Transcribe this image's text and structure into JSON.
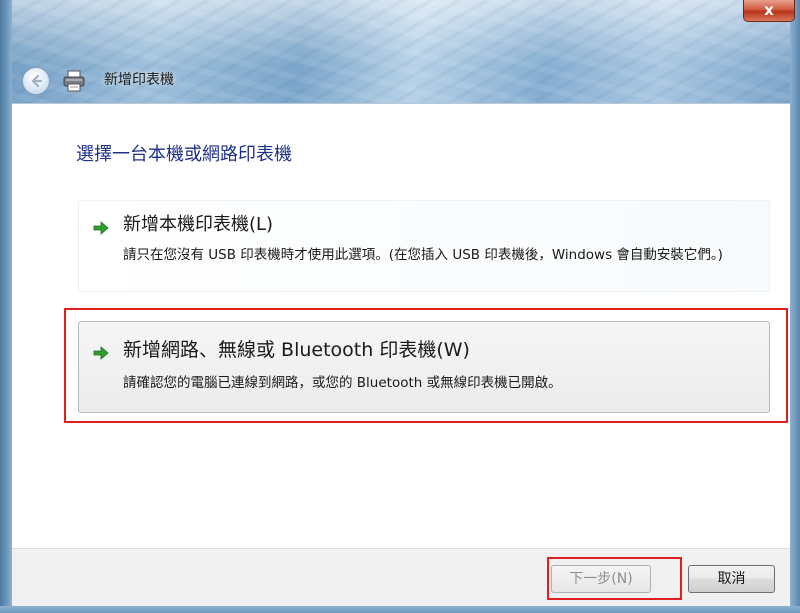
{
  "window": {
    "close_label": "x"
  },
  "nav": {
    "title": "新增印表機",
    "back_icon": "back-arrow-icon",
    "printer_icon": "printer-icon"
  },
  "main": {
    "heading": "選擇一台本機或網路印表機",
    "options": [
      {
        "title": "新增本機印表機(L)",
        "description": "請只在您沒有 USB 印表機時才使用此選項。(在您插入 USB 印表機後，Windows 會自動安裝它們。)",
        "icon": "green-arrow-icon"
      },
      {
        "title": "新增網路、無線或 Bluetooth 印表機(W)",
        "description": "請確認您的電腦已連線到網路，或您的 Bluetooth 或無線印表機已開啟。",
        "icon": "green-arrow-icon"
      }
    ]
  },
  "footer": {
    "next_label": "下一步(N)",
    "cancel_label": "取消",
    "next_enabled": false
  },
  "colors": {
    "heading": "#1e3287",
    "highlight_box": "#e02020",
    "arrow_green": "#2e9e2e"
  }
}
